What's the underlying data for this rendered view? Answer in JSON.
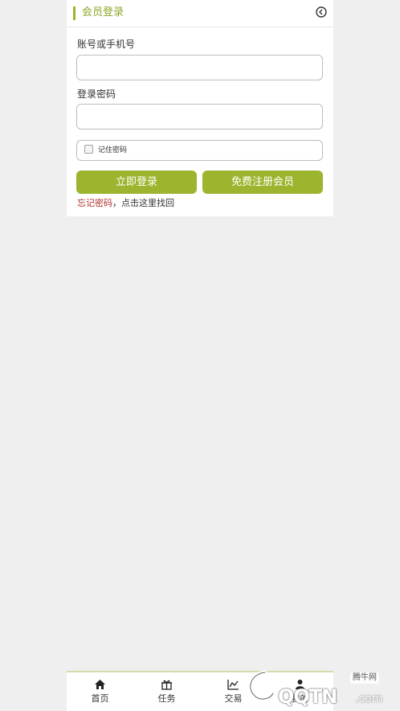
{
  "header": {
    "title": "会员登录",
    "back_icon": "circle-chevron-left-icon",
    "accent_color": "#9cb52e"
  },
  "form": {
    "account_label": "账号或手机号",
    "account_value": "",
    "password_label": "登录密码",
    "password_value": "",
    "remember_label": "记住密码",
    "remember_checked": false
  },
  "buttons": {
    "login_label": "立即登录",
    "register_label": "免费注册会员"
  },
  "forgot": {
    "link_text": "忘记密码",
    "rest_text": "，点击这里找回",
    "link_color": "#b0302a"
  },
  "bottom_nav": {
    "items": [
      {
        "label": "首页",
        "icon": "home-icon"
      },
      {
        "label": "任务",
        "icon": "gift-icon"
      },
      {
        "label": "交易",
        "icon": "chart-icon"
      },
      {
        "label": "我的",
        "icon": "user-icon"
      }
    ]
  },
  "watermark": {
    "site_name": "腾牛网",
    "logo_text": "QQTN",
    "suffix": ".com"
  }
}
